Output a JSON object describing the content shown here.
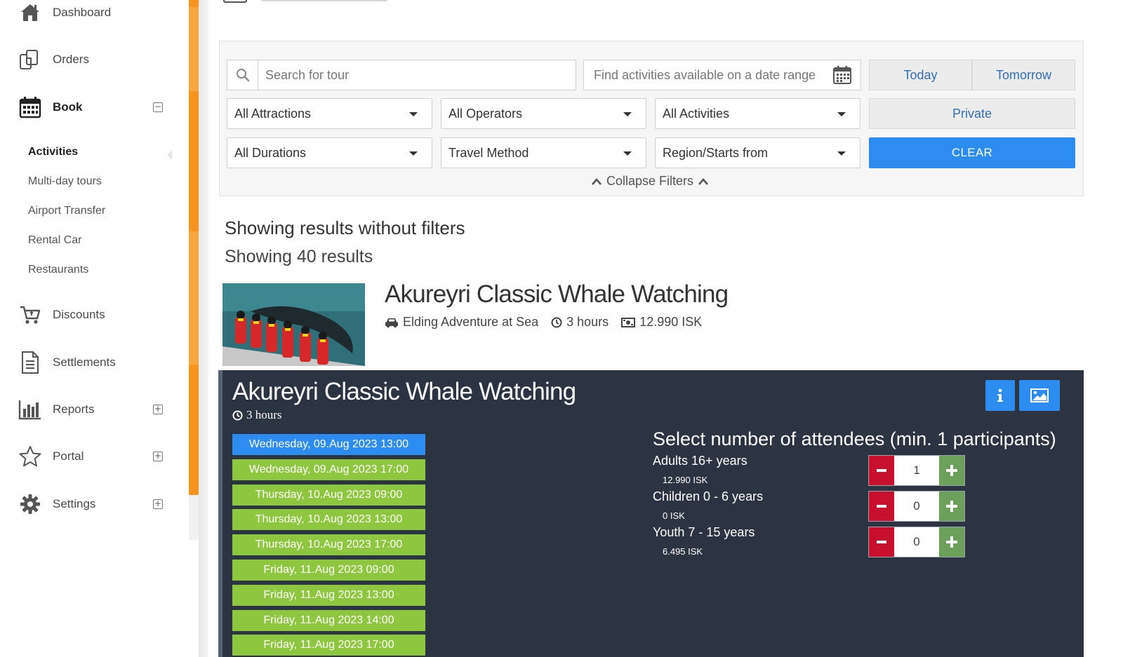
{
  "sidebar": {
    "items": [
      {
        "label": "Dashboard",
        "icon": "home-icon"
      },
      {
        "label": "Orders",
        "icon": "orders-icon"
      },
      {
        "label": "Book",
        "icon": "calendar-icon",
        "expanded": true
      },
      {
        "label": "Discounts",
        "icon": "cart-icon"
      },
      {
        "label": "Settlements",
        "icon": "document-icon"
      },
      {
        "label": "Reports",
        "icon": "bar-chart-icon"
      },
      {
        "label": "Portal",
        "icon": "star-icon"
      },
      {
        "label": "Settings",
        "icon": "gear-icon"
      }
    ],
    "book_subitems": [
      "Activities",
      "Multi-day tours",
      "Airport Transfer",
      "Rental Car",
      "Restaurants"
    ],
    "active_subitem": "Activities",
    "accent_color": "#f7941d"
  },
  "filters": {
    "search_placeholder": "Search for tour",
    "date_range_placeholder": "Find activities available on a date range",
    "today_label": "Today",
    "tomorrow_label": "Tomorrow",
    "attractions": "All Attractions",
    "operators": "All Operators",
    "activities": "All Activities",
    "private_label": "Private",
    "durations": "All Durations",
    "travel_method": "Travel Method",
    "region": "Region/Starts from",
    "clear_label": "CLEAR",
    "collapse_label": "Collapse Filters"
  },
  "results": {
    "title": "Showing results without filters",
    "count_text": "Showing 40 results"
  },
  "tour": {
    "name": "Akureyri Classic Whale Watching",
    "operator": "Elding Adventure at Sea",
    "duration": "3 hours",
    "price": "12.990 ISK"
  },
  "booking": {
    "title": "Akureyri Classic Whale Watching",
    "duration": "3 hours",
    "slots": [
      "Wednesday, 09.Aug 2023 13:00",
      "Wednesday, 09.Aug 2023 17:00",
      "Thursday, 10.Aug 2023 09:00",
      "Thursday, 10.Aug 2023 13:00",
      "Thursday, 10.Aug 2023 17:00",
      "Friday, 11.Aug 2023 09:00",
      "Friday, 11.Aug 2023 13:00",
      "Friday, 11.Aug 2023 14:00",
      "Friday, 11.Aug 2023 17:00"
    ],
    "selected_slot": 0,
    "attendees_heading": "Select number of attendees (min. 1 participants)",
    "attendees": [
      {
        "label": "Adults 16+ years",
        "price": "12.990 ISK",
        "count": "1"
      },
      {
        "label": "Children 0 - 6 years",
        "price": "0 ISK",
        "count": "0"
      },
      {
        "label": "Youth 7 - 15 years",
        "price": "6.495 ISK",
        "count": "0"
      }
    ],
    "colors": {
      "panel": "#2b3440",
      "slot": "#8dc63f",
      "selected": "#2d8cef",
      "minus": "#c8102e",
      "plus": "#6ba05a"
    }
  }
}
